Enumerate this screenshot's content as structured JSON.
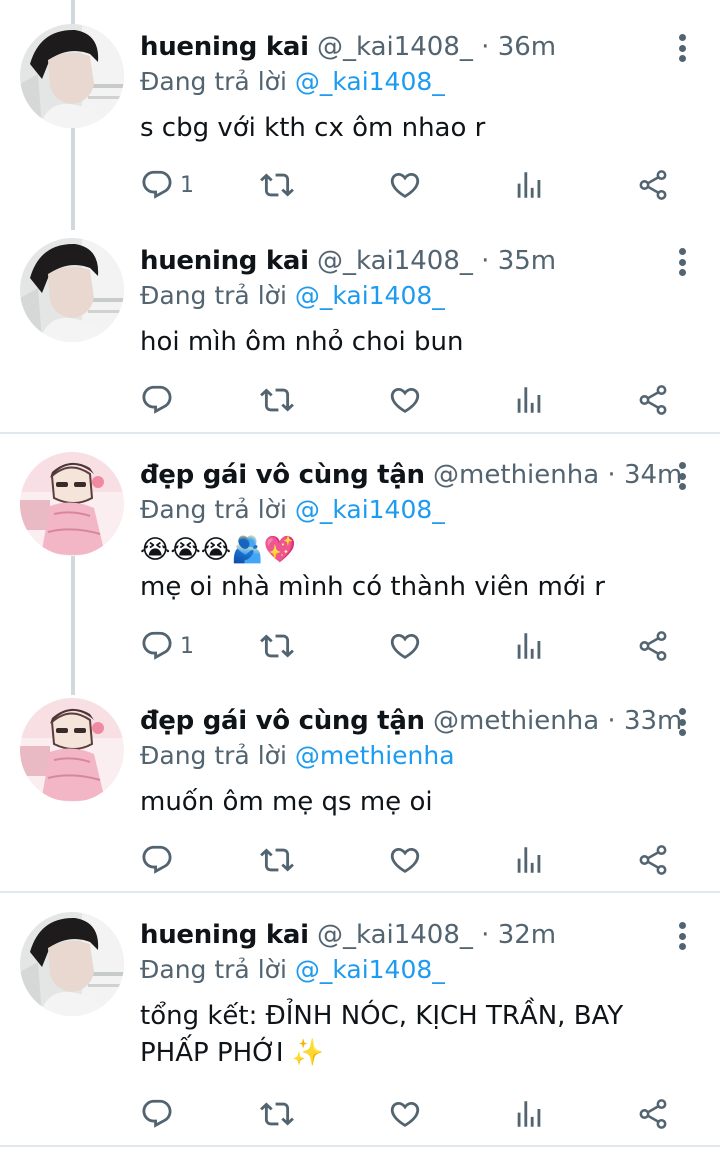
{
  "reply_prefix": "Đang trả lời",
  "tweets": [
    {
      "name": "huening kai",
      "handle": "@_kai1408_",
      "time": "36m",
      "reply_to": "@_kai1408_",
      "text": [
        "s cbg với kth cx ôm nhao r"
      ],
      "reply_count": "1",
      "avatar": "boy-avatar"
    },
    {
      "name": "huening kai",
      "handle": "@_kai1408_",
      "time": "35m",
      "reply_to": "@_kai1408_",
      "text": [
        "hoi mìh ôm nhỏ choi bun"
      ],
      "reply_count": "",
      "avatar": "boy-avatar"
    },
    {
      "name": "đẹp gái vô cùng tận",
      "handle": "@methienha",
      "time": "34m",
      "reply_to": "@_kai1408_",
      "text": [
        "😭😭😭🫂💖",
        "mẹ oi nhà mình có thành viên mới r"
      ],
      "reply_count": "1",
      "avatar": "cartoon-avatar"
    },
    {
      "name": "đẹp gái vô cùng tận",
      "handle": "@methienha",
      "time": "33m",
      "reply_to": "@methienha",
      "text": [
        "muốn ôm mẹ qs mẹ oi"
      ],
      "reply_count": "",
      "avatar": "cartoon-avatar"
    },
    {
      "name": "huening kai",
      "handle": "@_kai1408_",
      "time": "32m",
      "reply_to": "@_kai1408_",
      "text": [
        "tổng kết: ĐỈNH NÓC, KỊCH TRẦN, BAY",
        "PHẤP PHỚI ✨"
      ],
      "reply_count": "",
      "avatar": "boy-avatar"
    }
  ],
  "icons": [
    "reply-icon",
    "retweet-icon",
    "like-icon",
    "views-icon",
    "share-icon",
    "more-icon"
  ],
  "colors": {
    "mention": "#1d9bf0",
    "muted": "#536471",
    "text": "#0f1419",
    "divider": "#e1e8ed"
  }
}
